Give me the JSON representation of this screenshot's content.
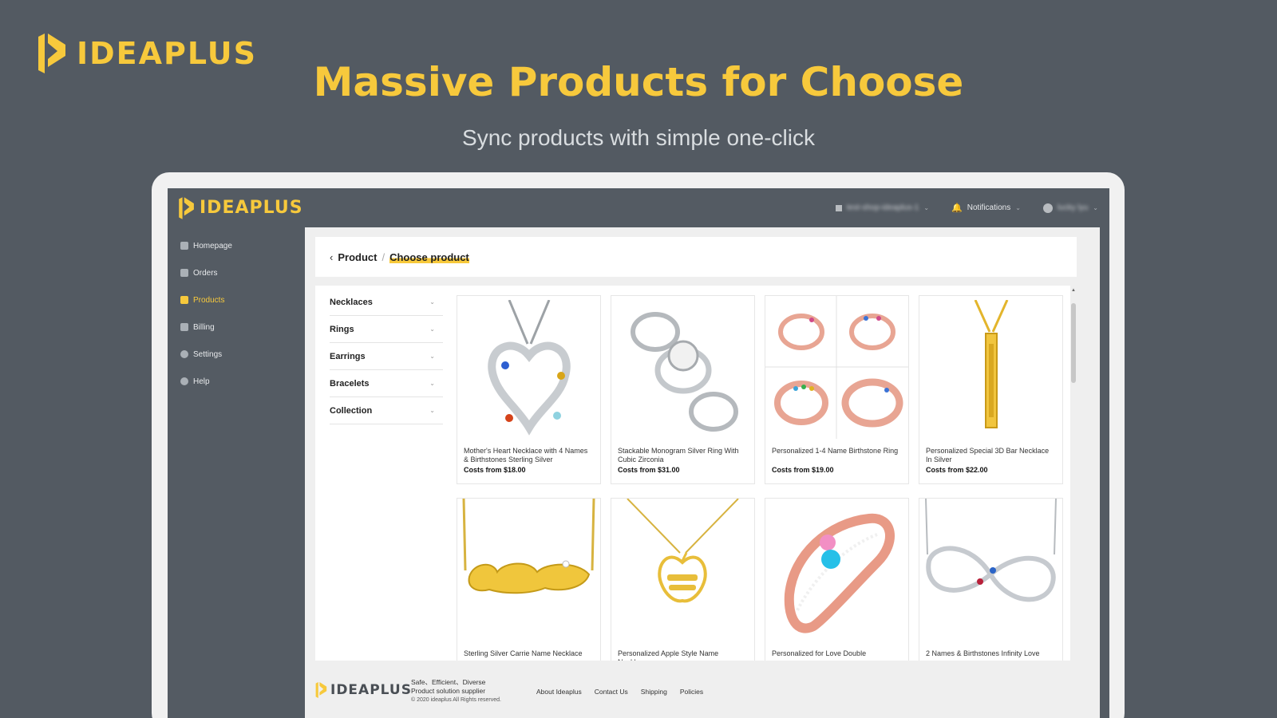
{
  "brand": {
    "name": "IDEAPLUS",
    "accent": "#f7c93c",
    "background": "#535a62"
  },
  "hero": {
    "title": "Massive Products for Choose",
    "subtitle": "Sync products with simple one-click"
  },
  "app": {
    "logo_text": "IDEAPLUS",
    "topbar": {
      "shop_label": "test-shop-ideaplus-1",
      "notifications_label": "Notifications",
      "user_label": "lucky lyu"
    },
    "sidebar": {
      "items": [
        {
          "label": "Homepage",
          "icon": "home-icon"
        },
        {
          "label": "Orders",
          "icon": "clipboard-icon"
        },
        {
          "label": "Products",
          "icon": "box-icon",
          "active": true
        },
        {
          "label": "Billing",
          "icon": "billing-icon"
        },
        {
          "label": "Settings",
          "icon": "gear-icon"
        },
        {
          "label": "Help",
          "icon": "help-icon"
        }
      ]
    },
    "breadcrumb": {
      "parent": "Product",
      "separator": "/",
      "current": "Choose product"
    },
    "categories": [
      "Necklaces",
      "Rings",
      "Earrings",
      "Bracelets",
      "Collection"
    ],
    "products": [
      {
        "name": "Mother's Heart Necklace with 4 Names & Birthstones Sterling Silver",
        "cost": "Costs from $18.00"
      },
      {
        "name": "Stackable Monogram Silver Ring With Cubic Zirconia",
        "cost": "Costs from $31.00"
      },
      {
        "name": "Personalized 1-4 Name Birthstone Ring",
        "cost": "Costs from $19.00"
      },
      {
        "name": "Personalized Special 3D Bar Necklace In Silver",
        "cost": "Costs from $22.00"
      },
      {
        "name": "Sterling Silver Carrie Name Necklace",
        "cost": ""
      },
      {
        "name": "Personalized Apple Style Name Necklace",
        "cost": ""
      },
      {
        "name": "Personalized for Love Double",
        "cost": ""
      },
      {
        "name": "2 Names & Birthstones Infinity Love",
        "cost": ""
      }
    ],
    "footer": {
      "logo_text": "IDEAPLUS",
      "tagline": "Safe、Efficient、Diverse",
      "tagline2": "Product solution supplier",
      "copyright": "© 2020 ideaplus All Rights reserved.",
      "links": [
        "About Ideaplus",
        "Contact Us",
        "Shipping",
        "Policies"
      ]
    }
  }
}
